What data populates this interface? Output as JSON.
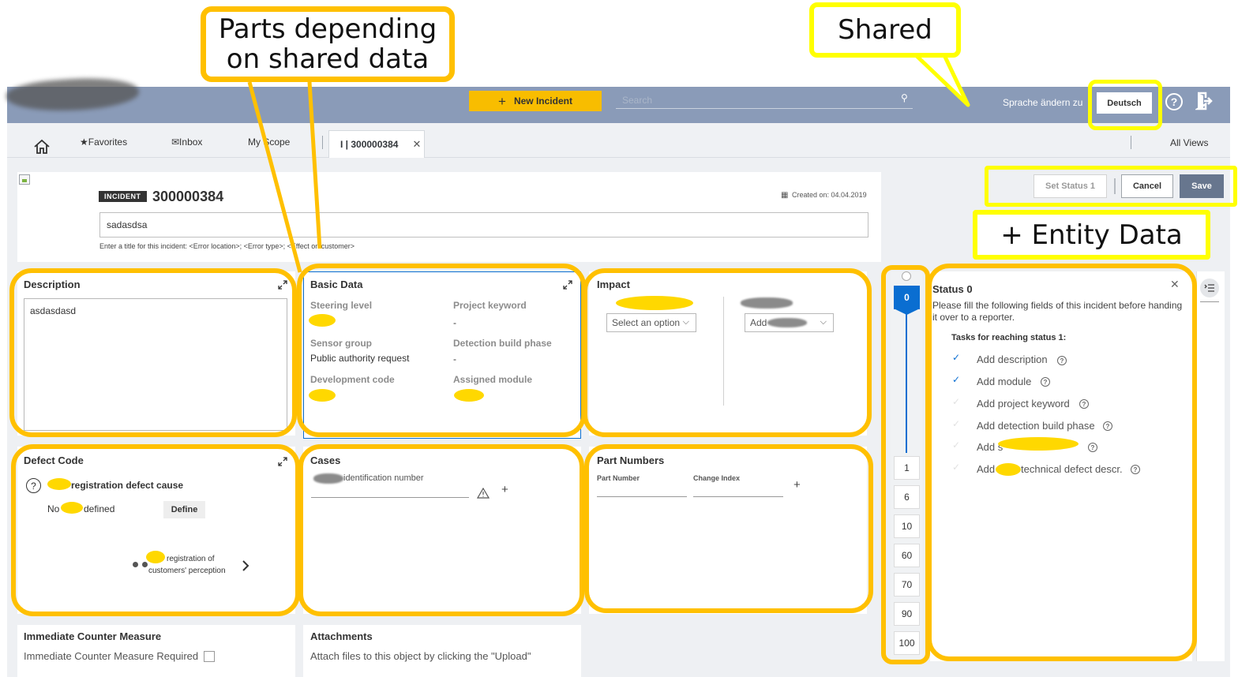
{
  "annotations": {
    "parts_depending": "Parts depending\non shared data",
    "shared": "Shared",
    "entity_data": "+ Entity Data"
  },
  "shell": {
    "new_incident": "New Incident",
    "search_placeholder": "Search",
    "change_language_label": "Sprache ändern zu",
    "language_button": "Deutsch"
  },
  "tabs": {
    "favorites": "★Favorites",
    "inbox": "✉Inbox",
    "my_scope": "My Scope",
    "active_tab": "I | 300000384",
    "all_views": "All Views"
  },
  "header": {
    "badge": "INCIDENT",
    "number": "300000384",
    "created_on": "Created on: 04.04.2019",
    "title_value": "sadasdsa",
    "title_hint": "Enter a title for this incident: <Error location>; <Error type>; <Effect on customer>"
  },
  "actions": {
    "set_status": "Set Status 1",
    "cancel": "Cancel",
    "save": "Save"
  },
  "description": {
    "title": "Description",
    "value": "asdasdasd"
  },
  "basic_data": {
    "title": "Basic Data",
    "steering_level_label": "Steering level",
    "project_keyword_label": "Project keyword",
    "project_keyword_value": "-",
    "sensor_group_label": "Sensor group",
    "sensor_group_value": "Public authority request",
    "detection_build_phase_label": "Detection build phase",
    "detection_build_phase_value": "-",
    "development_code_label": "Development code",
    "assigned_module_label": "Assigned module"
  },
  "impact": {
    "title": "Impact",
    "select_placeholder": "Select an option",
    "add_label": "Add"
  },
  "defect_code": {
    "title": "Defect Code",
    "cause_label": "registration defect cause",
    "no_defined_prefix": "No",
    "no_defined_suffix": "defined",
    "define_button": "Define",
    "perception_line1": "registration of",
    "perception_line2": "customers' perception"
  },
  "cases": {
    "title": "Cases",
    "id_label": "identification number"
  },
  "part_numbers": {
    "title": "Part Numbers",
    "col_part_number": "Part Number",
    "col_change_index": "Change Index"
  },
  "counter_measure": {
    "title": "Immediate Counter Measure",
    "required_label": "Immediate Counter Measure Required"
  },
  "attachments": {
    "title": "Attachments",
    "hint": "Attach files to this object by clicking the \"Upload\""
  },
  "status_steps": {
    "current": "0",
    "steps": [
      "1",
      "6",
      "10",
      "60",
      "70",
      "90",
      "100"
    ]
  },
  "status_panel": {
    "title": "Status 0",
    "description": "Please fill the following fields of this incident before handing it over to a reporter.",
    "tasks_heading": "Tasks for reaching status 1:",
    "tasks": [
      {
        "label": "Add description",
        "done": true
      },
      {
        "label": "Add module",
        "done": true
      },
      {
        "label": "Add project keyword",
        "done": false
      },
      {
        "label": "Add detection build phase",
        "done": false
      },
      {
        "label": "Add s",
        "done": false
      },
      {
        "label": "Add",
        "done": false
      }
    ],
    "task6_suffix": "technical defect descr."
  },
  "colors": {
    "shell": "#8a9bb8",
    "accent_yellow": "#f8bd00",
    "annotation_orange": "#ffc000",
    "annotation_yellow": "#ffff00",
    "primary_blue": "#0a6ed1",
    "save_button": "#67768e"
  }
}
